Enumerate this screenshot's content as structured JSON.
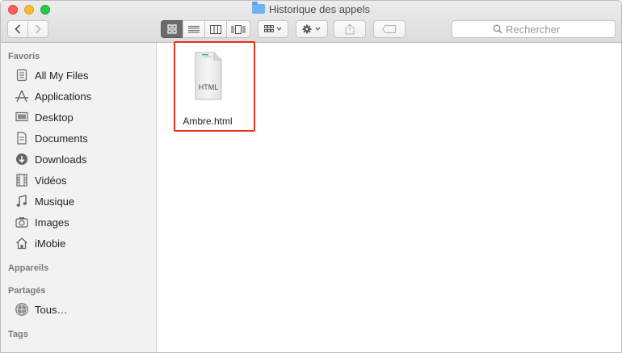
{
  "window": {
    "title": "Historique des appels"
  },
  "toolbar": {
    "back_icon": "chevron-left-icon",
    "forward_icon": "chevron-right-icon",
    "view_modes": [
      "icon-view",
      "list-view",
      "column-view",
      "cover-flow-view"
    ],
    "active_view": "icon-view",
    "arrange_icon": "grid-arrange-icon",
    "action_icon": "gear-icon",
    "share_icon": "share-icon",
    "tag_icon": "tag-icon"
  },
  "search": {
    "placeholder": "Rechercher"
  },
  "sidebar": {
    "favorites_title": "Favoris",
    "favorites": [
      {
        "label": "All My Files",
        "icon": "all-files-icon"
      },
      {
        "label": "Applications",
        "icon": "applications-icon"
      },
      {
        "label": "Desktop",
        "icon": "desktop-icon"
      },
      {
        "label": "Documents",
        "icon": "documents-icon"
      },
      {
        "label": "Downloads",
        "icon": "downloads-icon"
      },
      {
        "label": "Vidéos",
        "icon": "movies-icon"
      },
      {
        "label": "Musique",
        "icon": "music-icon"
      },
      {
        "label": "Images",
        "icon": "camera-icon"
      },
      {
        "label": "iMobie",
        "icon": "home-icon"
      }
    ],
    "devices_title": "Appareils",
    "shared_title": "Partagés",
    "shared": [
      {
        "label": "Tous…",
        "icon": "network-icon"
      }
    ],
    "tags_title": "Tags"
  },
  "files": [
    {
      "name": "Ambre.html",
      "type_label": "HTML",
      "icon": "html-file-icon"
    }
  ],
  "colors": {
    "highlight": "#e8321e",
    "folder": "#6fb4f0"
  }
}
